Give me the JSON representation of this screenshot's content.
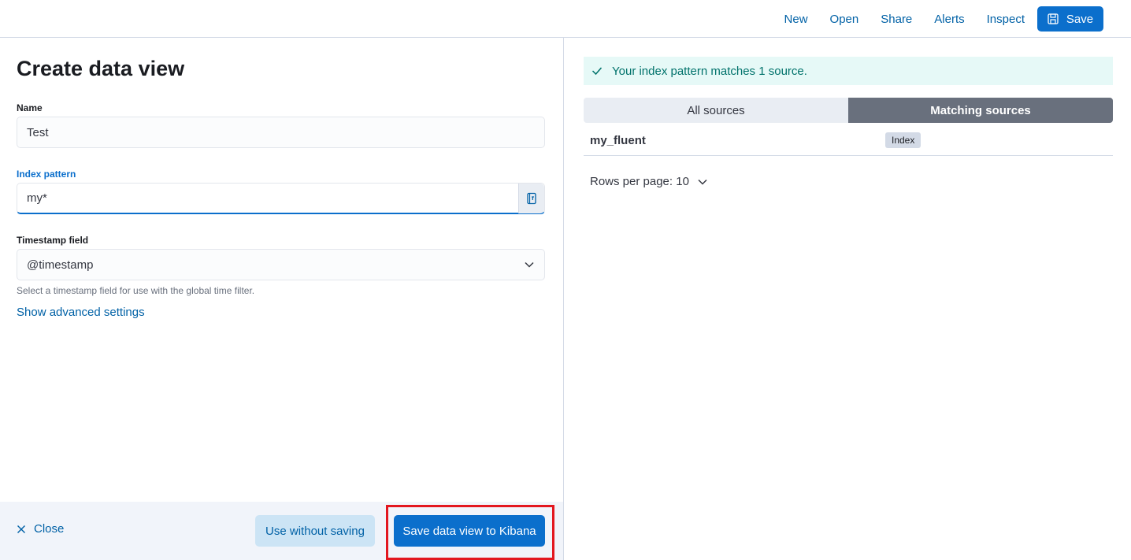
{
  "topbar": {
    "links": [
      "New",
      "Open",
      "Share",
      "Alerts",
      "Inspect"
    ],
    "save_label": "Save"
  },
  "form": {
    "title": "Create data view",
    "name_label": "Name",
    "name_value": "Test",
    "index_label": "Index pattern",
    "index_value": "my*",
    "timestamp_label": "Timestamp field",
    "timestamp_value": "@timestamp",
    "timestamp_help": "Select a timestamp field for use with the global time filter.",
    "advanced_link": "Show advanced settings"
  },
  "footer": {
    "close_label": "Close",
    "use_label": "Use without saving",
    "save_label": "Save data view to Kibana"
  },
  "preview": {
    "callout": "Your index pattern matches 1 source.",
    "tabs": [
      "All sources",
      "Matching sources"
    ],
    "rows": [
      {
        "name": "my_fluent",
        "type": "Index"
      }
    ],
    "rows_per_page": "Rows per page: 10"
  },
  "colors": {
    "primary": "#0b6fcc",
    "success": "#00726b",
    "highlight": "#e3171f"
  }
}
